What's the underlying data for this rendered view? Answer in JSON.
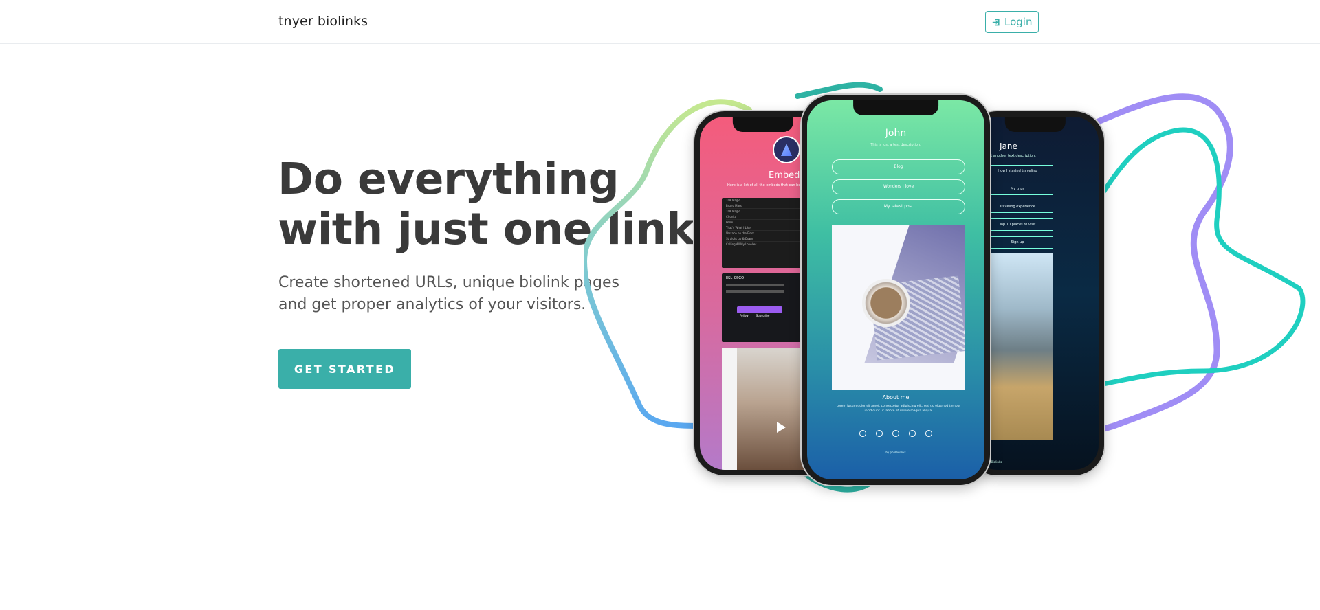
{
  "nav": {
    "brand": "tnyer biolinks",
    "login_label": "Login",
    "login_icon": "sign-in-icon"
  },
  "hero": {
    "title_line1": "Do everything",
    "title_line2": "with just one link.",
    "subtitle": "Create shortened URLs, unique biolink pages and get proper analytics of your visitors.",
    "cta_label": "GET STARTED"
  },
  "colors": {
    "accent": "#3aafa9",
    "title": "#3a3a3a"
  },
  "showcase": {
    "left_phone": {
      "title": "Embeds",
      "subtitle": "Here is a list of all the embeds that can be used",
      "track_title": "24K Magic",
      "track_artist": "Bruno Mars",
      "tracks": [
        "24K Magic",
        "Chunky",
        "Perm",
        "That's What I Like",
        "Versace on the Floor",
        "Straight up & Down",
        "Calling All My Lovelies"
      ],
      "stream_title": "ESL_CSGO",
      "follow_label": "Follow",
      "subscribe_label": "Subscribe"
    },
    "center_phone": {
      "name": "John",
      "description": "This is just a test description.",
      "links": [
        "Blog",
        "Wonders I love",
        "My latest post"
      ],
      "about_title": "About me",
      "about_text": "Lorem ipsum dolor sit amet, consectetur adipiscing elit, sed do eiusmod tempor incididunt ut labore et dolore magna aliqua.",
      "footer": "by phpBiolinks",
      "social_icons": [
        "whatsapp-icon",
        "messenger-icon",
        "instagram-icon",
        "twitter-icon",
        "tiktok-icon"
      ]
    },
    "right_phone": {
      "name": "Jane",
      "description": "Just another text description.",
      "links": [
        "How I started traveling",
        "My trips",
        "Traveling experience",
        "Top 10 places to visit",
        "Sign up"
      ],
      "footer": "by phpBiolinks"
    }
  }
}
